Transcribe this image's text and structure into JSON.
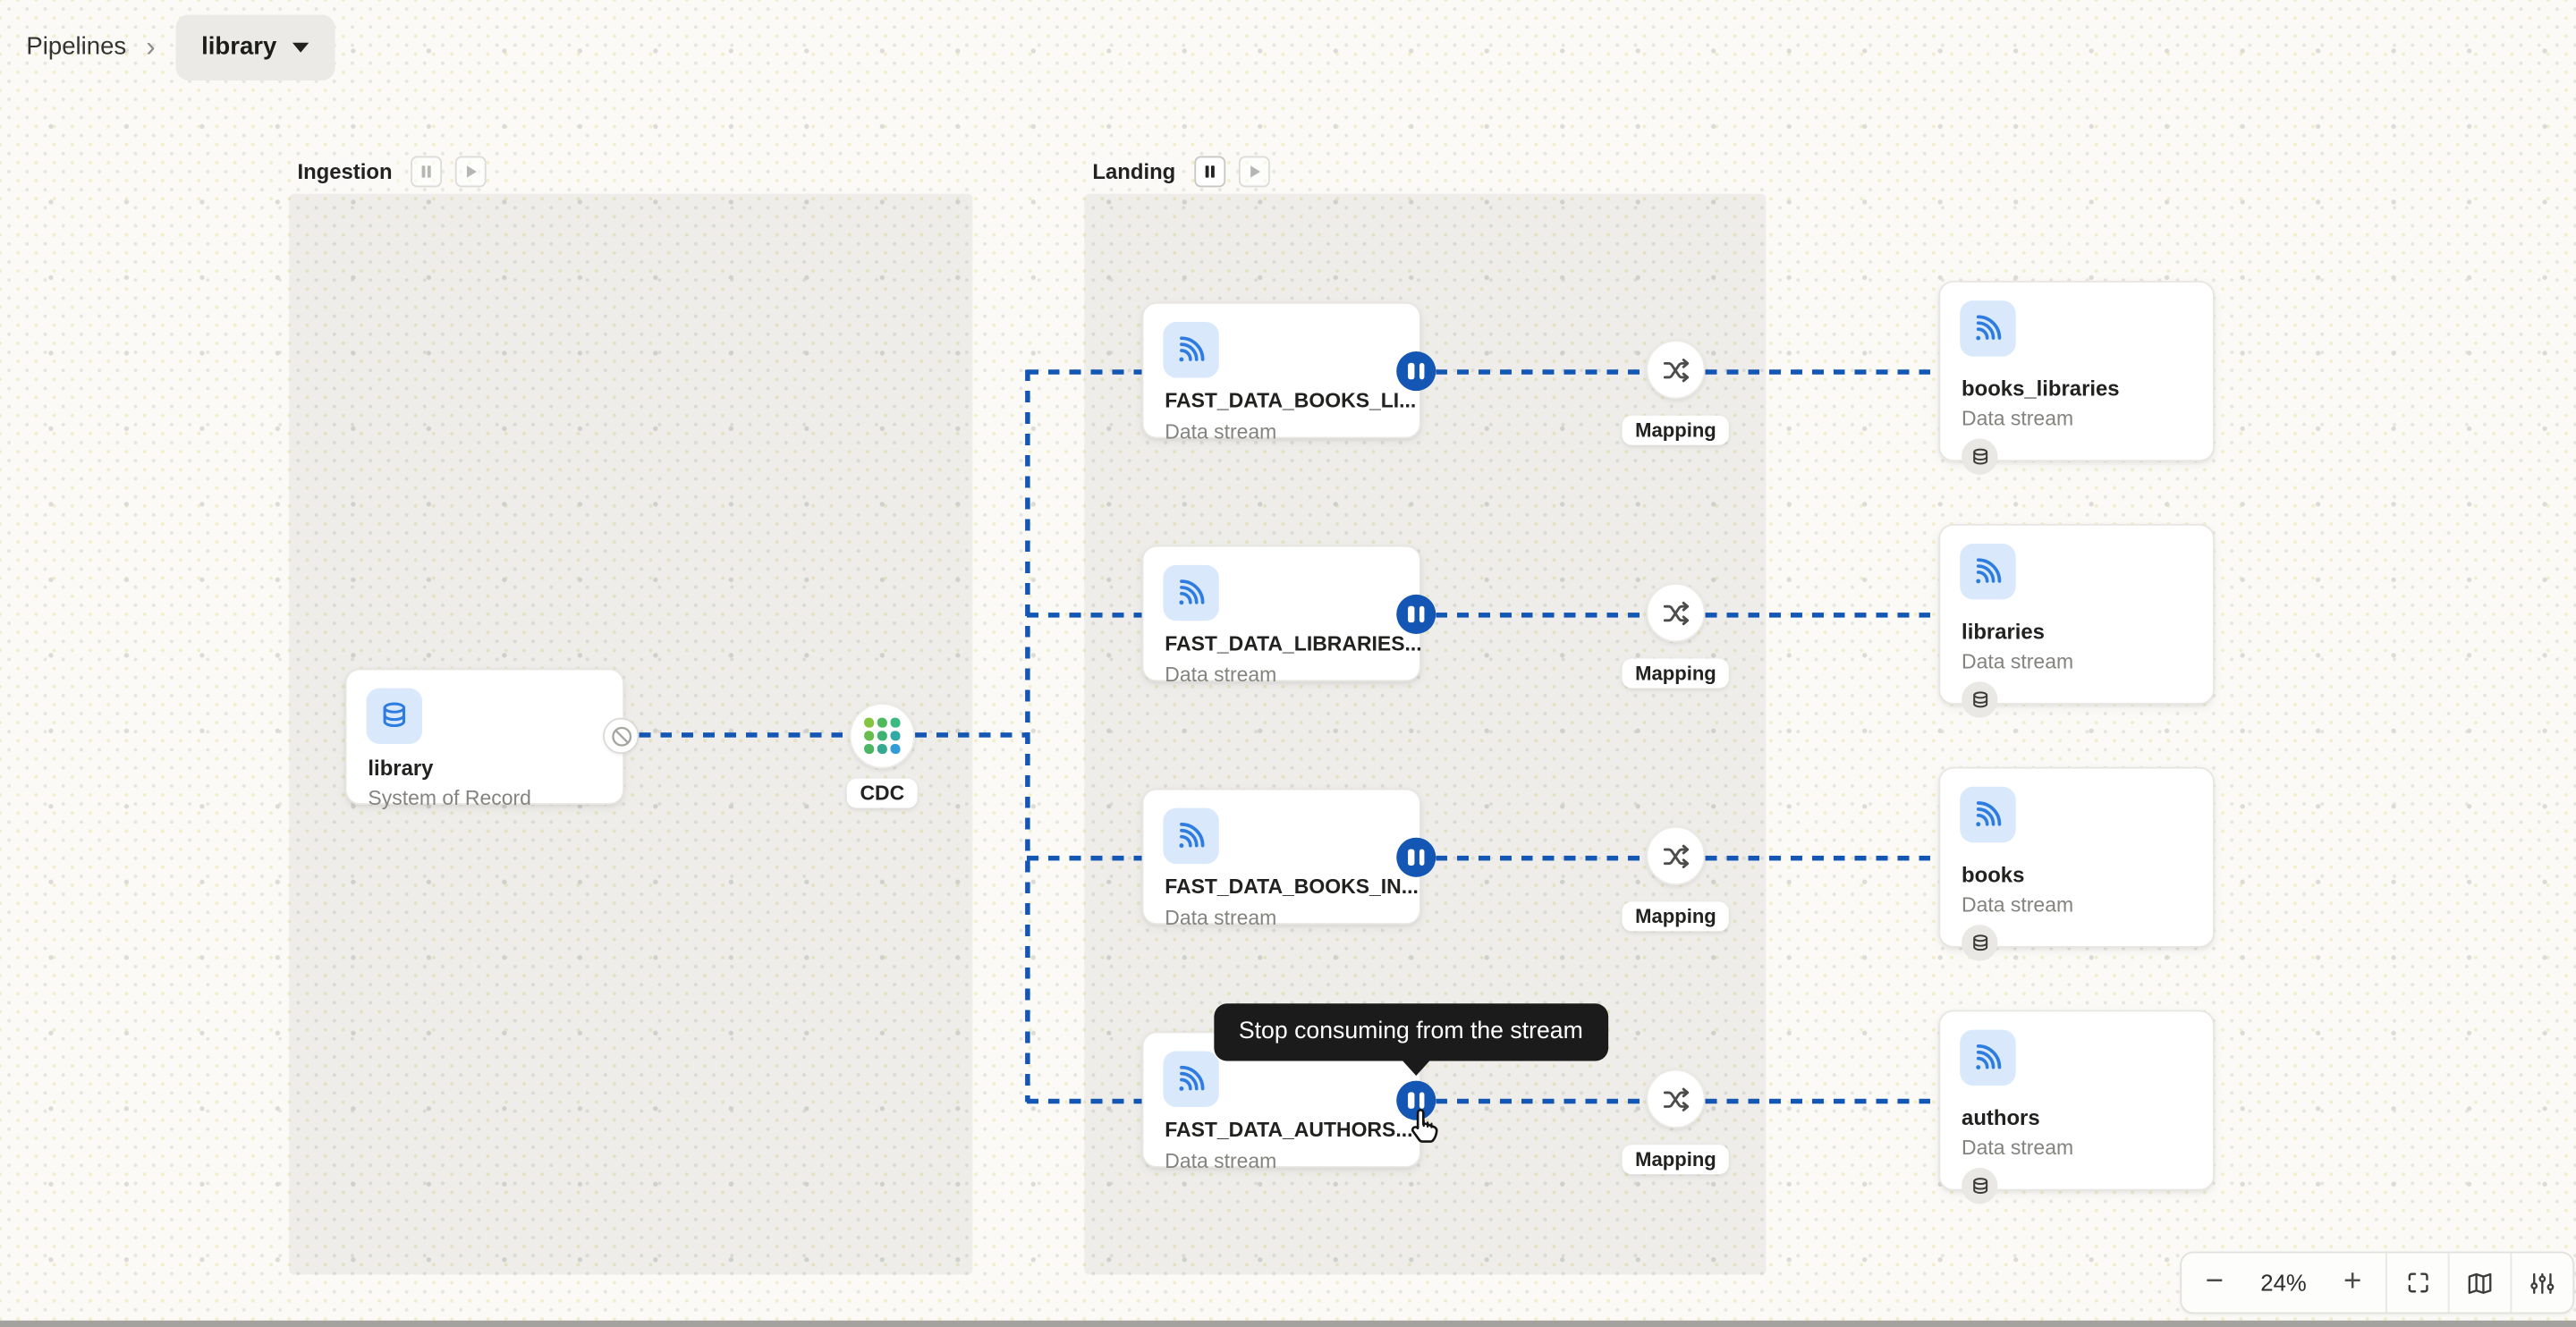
{
  "breadcrumb": {
    "root": "Pipelines",
    "separator": "›",
    "current": "library"
  },
  "groups": [
    {
      "label": "Ingestion",
      "pause_enabled": false,
      "play_enabled": false
    },
    {
      "label": "Landing",
      "pause_enabled": true,
      "play_enabled": false
    }
  ],
  "canvas": {
    "source_node": {
      "title": "library",
      "subtitle": "System of Record"
    },
    "cdc_node": {
      "label": "CDC"
    },
    "mapping_label": "Mapping",
    "stream_nodes": [
      {
        "title": "FAST_DATA_BOOKS_LI...",
        "subtitle": "Data stream"
      },
      {
        "title": "FAST_DATA_LIBRARIES...",
        "subtitle": "Data stream"
      },
      {
        "title": "FAST_DATA_BOOKS_IN...",
        "subtitle": "Data stream"
      },
      {
        "title": "FAST_DATA_AUTHORS...",
        "subtitle": "Data stream"
      }
    ],
    "output_nodes": [
      {
        "title": "books_libraries",
        "subtitle": "Data stream"
      },
      {
        "title": "libraries",
        "subtitle": "Data stream"
      },
      {
        "title": "books",
        "subtitle": "Data stream"
      },
      {
        "title": "authors",
        "subtitle": "Data stream"
      }
    ],
    "tooltip": "Stop consuming from the stream"
  },
  "zoom_toolbar": {
    "zoom_out": "−",
    "zoom_level": "24%",
    "zoom_in": "+"
  },
  "colors": {
    "edge_blue": "#1456b4",
    "pause_button_blue": "#1456b4",
    "stream_icon_blue": "#2e7ce0",
    "stream_icon_bg": "#d9e9fb",
    "group_gray": "#e9e8e4",
    "tooltip_bg": "#1b1b1c",
    "canvas_bg": "#fbfaf7"
  },
  "icons": {
    "stream": "wifi-arcs",
    "database": "db-cylinder",
    "mapping": "shuffle-arrows",
    "cdc": "leaf-grid-logo",
    "pause": "pause-bars",
    "play": "play-triangle",
    "blocked": "no-entry-circle",
    "fullscreen": "corner-brackets",
    "minimap": "folded-map",
    "settings": "sliders",
    "cursor": "hand-pointer",
    "dropdown": "caret-down"
  }
}
